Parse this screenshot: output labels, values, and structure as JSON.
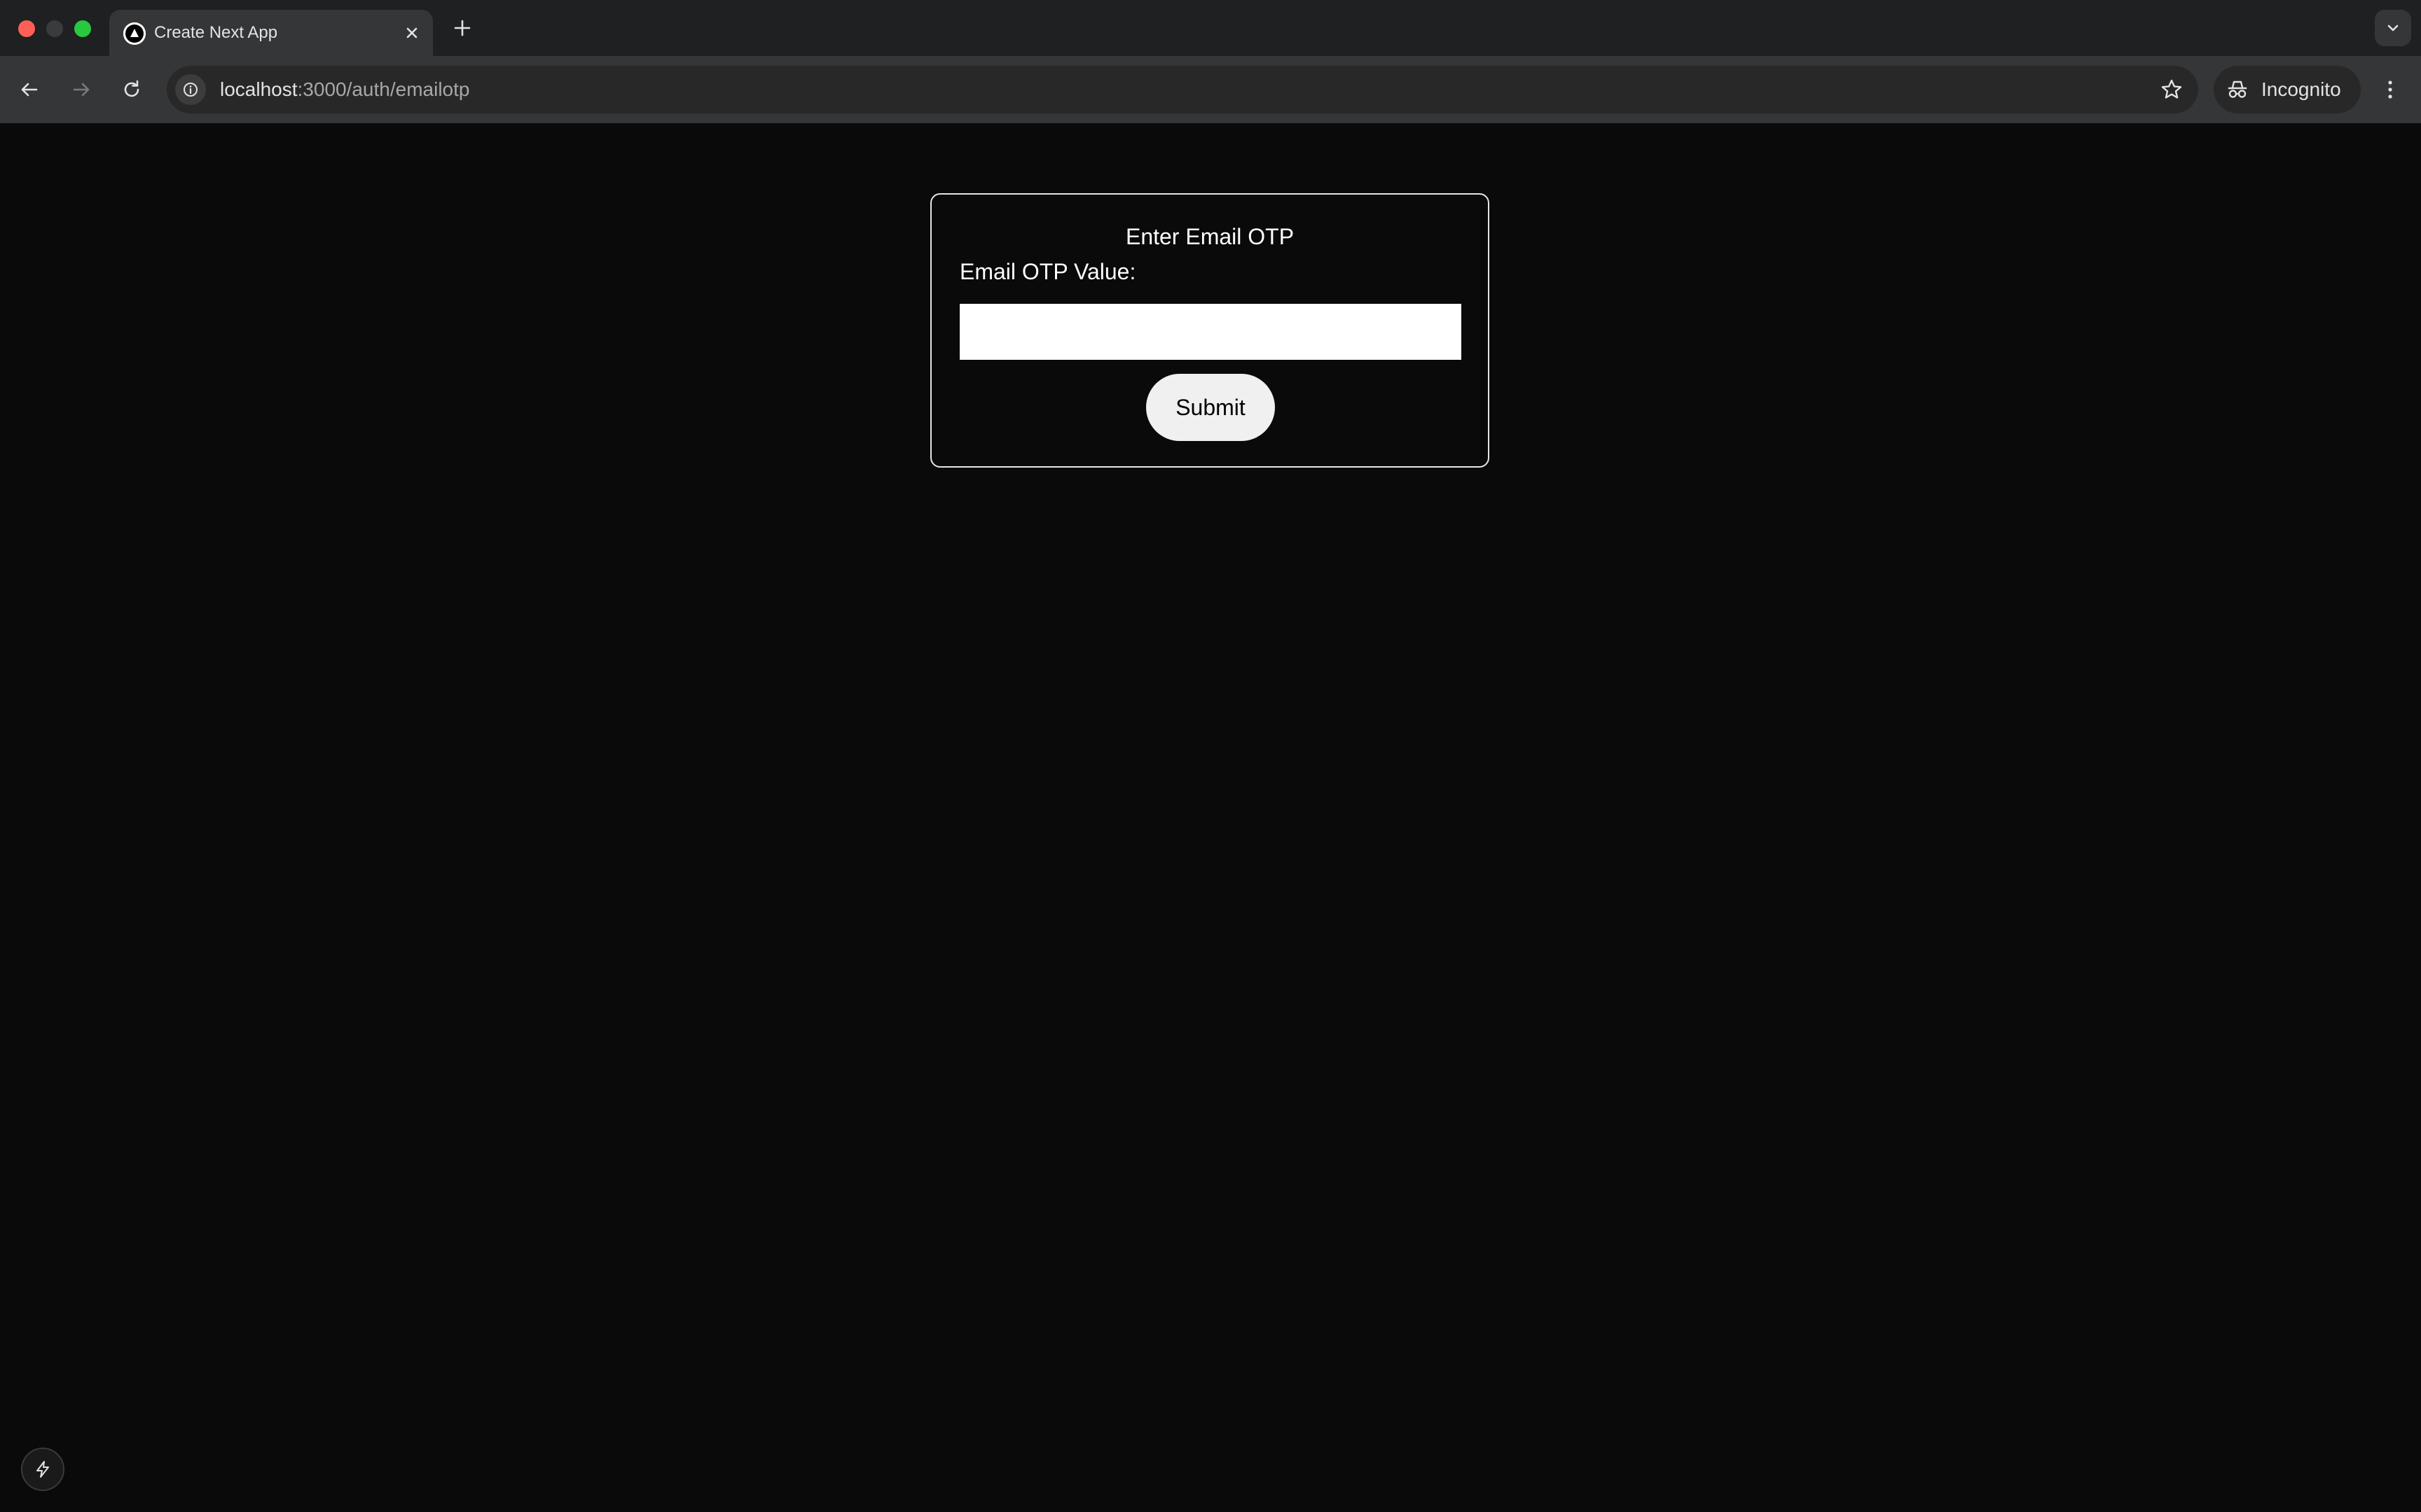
{
  "browser": {
    "tab": {
      "title": "Create Next App"
    },
    "address": {
      "host": "localhost",
      "path": ":3000/auth/emailotp"
    },
    "profile": {
      "label": "Incognito"
    }
  },
  "form": {
    "title": "Enter Email OTP",
    "otp_label": "Email OTP Value:",
    "otp_value": "",
    "submit_label": "Submit"
  },
  "icons": {
    "favicon": "nextjs-triangle-icon",
    "dev_indicator": "lightning-bolt-icon"
  },
  "colors": {
    "page_background": "#0a0a0a",
    "card_border": "#e6e6e6",
    "button_background": "#f0f0f0",
    "close_window": "#ff5f57",
    "maximize_window": "#28c840"
  }
}
